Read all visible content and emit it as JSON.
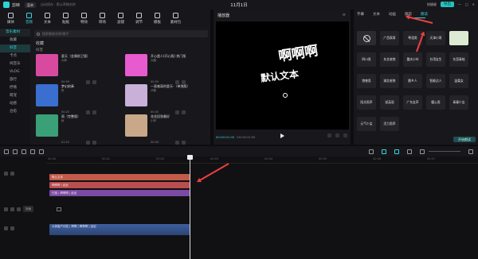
{
  "titlebar": {
    "app_name": "剪映",
    "menu": "菜单",
    "draft": "自动保存 · 默认草稿名称",
    "date": "11月1日",
    "right_buttons": [
      "快捷键",
      "导出"
    ]
  },
  "toolbar": {
    "items": [
      "媒体",
      "音频",
      "文本",
      "贴纸",
      "特效",
      "转场",
      "滤镜",
      "调节",
      "模板",
      "素材包"
    ],
    "active": 1
  },
  "leftpanel": {
    "items": [
      "音乐素材",
      "收藏",
      "抖音",
      "卡点",
      "纯音乐",
      "VLOG",
      "旅行",
      "抒情",
      "萌宠",
      "动感",
      "治愈"
    ],
    "active": 2
  },
  "search": {
    "placeholder": "搜索歌曲名称/歌手"
  },
  "content": {
    "section_label": "收藏",
    "subsection_label": "抖音",
    "cards": [
      {
        "title": "夏天（金属前卫版）",
        "artist": "大郎",
        "duration": "00:59",
        "color": "#d84aa0"
      },
      {
        "title": "开心超人(开心版) 热门版",
        "artist": "大鹏",
        "duration": "00:30",
        "color": "#e85ad0"
      },
      {
        "title": "梦幻前奏",
        "artist": "陈",
        "duration": "00:25",
        "color": "#3a6fd0"
      },
      {
        "title": "一直难离的夏天-（单独版）",
        "artist": "卢敏",
        "duration": "00:45",
        "color": "#c8b0d8"
      },
      {
        "title": "雨（完整版）",
        "artist": "秋",
        "duration": "01:22",
        "color": "#3aa078"
      },
      {
        "title": "花花回答最好",
        "artist": "小林",
        "duration": "00:43",
        "color": "#c8a888"
      }
    ]
  },
  "player": {
    "title": "播放器",
    "big_text": "啊啊啊",
    "small_text": "默认文本",
    "time_current": "00:00:01:00",
    "time_total": "00:00:01:00"
  },
  "textpanel": {
    "tabs": [
      "字幕",
      "文本",
      "动画",
      "跟踪",
      "朗读"
    ],
    "active_tab": 4,
    "voices": [
      "广西表哥",
      "粤语男",
      "天津小哥",
      "四川男",
      "东北老铁",
      "重庆小伙",
      "台湾女生",
      "东莞青蛙",
      "港普男",
      "湖北老铁",
      "脆乡人",
      "智能达人",
      "温柔女",
      "阳光男声",
      "说英语",
      "广东女声",
      "暖心男",
      "青春少女",
      "元气少女",
      "活力男声"
    ],
    "footer_button": "开始朗读"
  },
  "timeline": {
    "ruler": [
      "00:00",
      "00:01",
      "00:02",
      "00:03",
      "00:04",
      "00:05",
      "00:06",
      "00:07"
    ],
    "track_label": "封面",
    "text_clip": "默认文本",
    "clips": [
      {
        "label": "啊啊啊 | 延迟",
        "color": "#b94e4e"
      },
      {
        "label": "扫描 | 啊啊啊 | 延迟",
        "color": "#7b4aa2"
      }
    ],
    "audio_clip": "大侠客户问答 | 啊啊 | 啊啊啊 | 延迟"
  }
}
